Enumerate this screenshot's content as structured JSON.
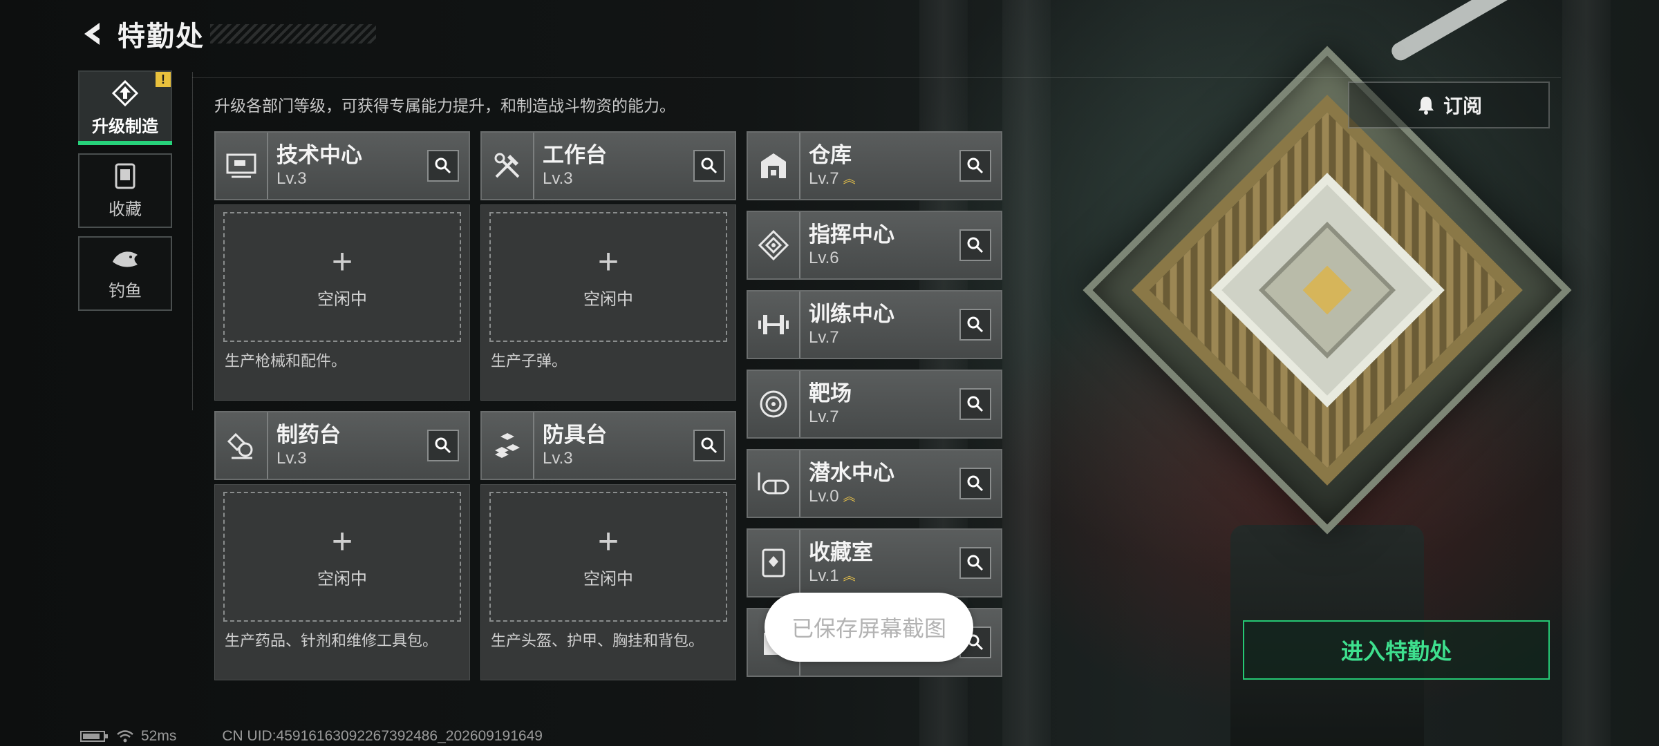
{
  "header": {
    "title": "特勤处"
  },
  "nav": {
    "items": [
      {
        "label": "升级制造",
        "icon": "upgrade-icon",
        "active": true,
        "alert": "!"
      },
      {
        "label": "收藏",
        "icon": "collection-icon"
      },
      {
        "label": "钓鱼",
        "icon": "fish-icon"
      }
    ]
  },
  "description": "升级各部门等级，可获得专属能力提升，和制造战斗物资的能力。",
  "production": [
    {
      "name": "技术中心",
      "level": "Lv.3",
      "slot": "空闲中",
      "desc": "生产枪械和配件。",
      "icon": "tech-center-icon"
    },
    {
      "name": "工作台",
      "level": "Lv.3",
      "slot": "空闲中",
      "desc": "生产子弹。",
      "icon": "workbench-icon"
    },
    {
      "name": "制药台",
      "level": "Lv.3",
      "slot": "空闲中",
      "desc": "生产药品、针剂和维修工具包。",
      "icon": "pharmacy-icon"
    },
    {
      "name": "防具台",
      "level": "Lv.3",
      "slot": "空闲中",
      "desc": "生产头盔、护甲、胸挂和背包。",
      "icon": "armor-bench-icon"
    }
  ],
  "facilities": [
    {
      "name": "仓库",
      "level": "Lv.7",
      "upgrade": true,
      "icon": "warehouse-icon"
    },
    {
      "name": "指挥中心",
      "level": "Lv.6",
      "upgrade": false,
      "icon": "command-center-icon"
    },
    {
      "name": "训练中心",
      "level": "Lv.7",
      "upgrade": false,
      "icon": "training-center-icon"
    },
    {
      "name": "靶场",
      "level": "Lv.7",
      "upgrade": false,
      "icon": "shooting-range-icon"
    },
    {
      "name": "潜水中心",
      "level": "Lv.0",
      "upgrade": true,
      "icon": "diving-center-icon"
    },
    {
      "name": "收藏室",
      "level": "Lv.1",
      "upgrade": true,
      "icon": "collection-room-icon"
    },
    {
      "name": "",
      "level": "",
      "upgrade": true,
      "icon": "facility-icon"
    }
  ],
  "subscribe_label": "订阅",
  "enter_label": "进入特勤处",
  "toast": "已保存屏幕截图",
  "status": {
    "ping": "52ms",
    "uid": "CN UID:4591616309226739​2486_202609191649"
  },
  "colors": {
    "accent": "#27d27b",
    "upgrade_arrow": "#e8c24a",
    "alert": "#e9c13d"
  }
}
